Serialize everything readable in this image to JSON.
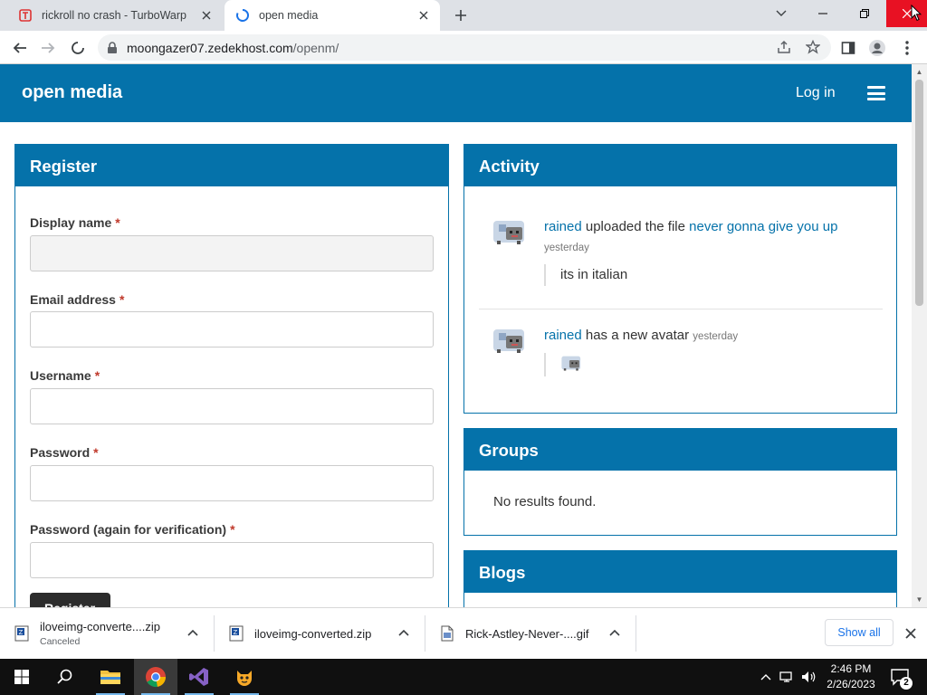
{
  "browser": {
    "tabs": [
      {
        "title": "rickroll no crash - TurboWarp",
        "favicon": "turbowarp-icon",
        "active": false
      },
      {
        "title": "open media",
        "favicon": "loading-spinner-icon",
        "active": true
      }
    ],
    "url_host": "moongazer07.zedekhost.com",
    "url_path": "/openm/"
  },
  "site": {
    "brand": "open media",
    "login_label": "Log in",
    "register": {
      "title": "Register",
      "fields": [
        {
          "label": "Display name",
          "required": "*"
        },
        {
          "label": "Email address",
          "required": "*"
        },
        {
          "label": "Username",
          "required": "*"
        },
        {
          "label": "Password",
          "required": "*"
        },
        {
          "label": "Password (again for verification)",
          "required": "*"
        }
      ],
      "button_label": "Register"
    },
    "activity": {
      "title": "Activity",
      "items": [
        {
          "user": "rained",
          "action": "uploaded the file",
          "target": "never gonna give you up",
          "time": "yesterday",
          "quote": "its in italian"
        },
        {
          "user": "rained",
          "action": "has a new avatar",
          "time": "yesterday"
        }
      ]
    },
    "groups": {
      "title": "Groups",
      "empty": "No results found."
    },
    "blogs": {
      "title": "Blogs"
    }
  },
  "downloads": {
    "items": [
      {
        "name": "iloveimg-converte....zip",
        "status": "Canceled",
        "icon": "zip-file-icon"
      },
      {
        "name": "iloveimg-converted.zip",
        "icon": "zip-file-icon"
      },
      {
        "name": "Rick-Astley-Never-....gif",
        "icon": "gif-file-icon"
      }
    ],
    "show_all": "Show all"
  },
  "taskbar": {
    "time": "2:46 PM",
    "date": "2/26/2023",
    "notification_count": "2",
    "apps": [
      "start-icon",
      "search-icon",
      "file-explorer-icon",
      "chrome-icon",
      "visual-studio-icon",
      "scratch-icon"
    ]
  },
  "colors": {
    "brand": "#0572aa",
    "link": "#0572aa",
    "required": "#c0392b",
    "tabstrip": "#dee1e6",
    "close_red": "#e81123"
  }
}
